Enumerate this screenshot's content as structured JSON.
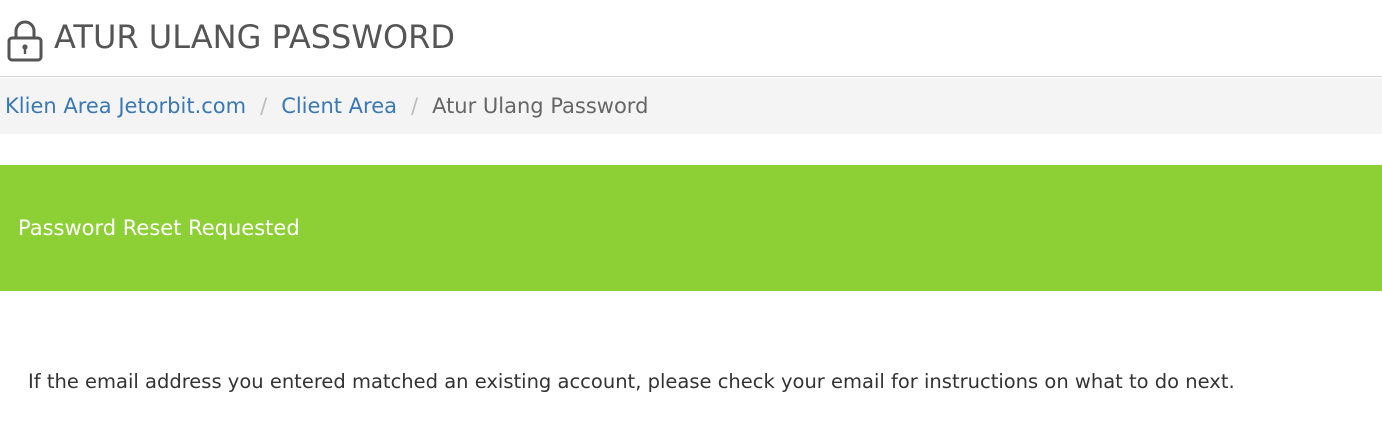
{
  "header": {
    "title": "ATUR ULANG PASSWORD",
    "icon": "lock-icon"
  },
  "breadcrumb": {
    "items": [
      {
        "label": "Klien Area Jetorbit.com",
        "link": true
      },
      {
        "label": "Client Area",
        "link": true
      },
      {
        "label": "Atur Ulang Password",
        "link": false
      }
    ],
    "separator": "/"
  },
  "alert": {
    "text": "Password Reset Requested",
    "color": "#8dd035"
  },
  "message": {
    "text": "If the email address you entered matched an existing account, please check your email for instructions on what to do next."
  },
  "colors": {
    "link": "#3a78b5",
    "title": "#555555",
    "breadcrumb_bg": "#f4f4f4"
  }
}
